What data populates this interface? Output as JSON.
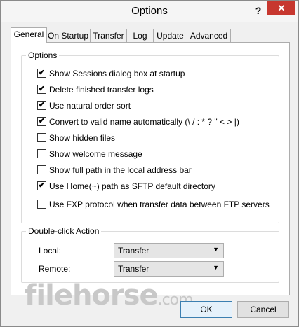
{
  "window": {
    "title": "Options",
    "help_label": "?",
    "close_label": "✕"
  },
  "tabs": [
    {
      "label": "General",
      "active": true
    },
    {
      "label": "On Startup",
      "active": false
    },
    {
      "label": "Transfer",
      "active": false
    },
    {
      "label": "Log",
      "active": false
    },
    {
      "label": "Update",
      "active": false
    },
    {
      "label": "Advanced",
      "active": false
    }
  ],
  "options": {
    "group_label": "Options",
    "items": [
      {
        "label": "Show Sessions dialog box at startup",
        "checked": true
      },
      {
        "label": "Delete finished transfer logs",
        "checked": true
      },
      {
        "label": "Use natural order sort",
        "checked": true
      },
      {
        "label": "Convert to valid name automatically (\\ / : * ? \" < > |)",
        "checked": true
      },
      {
        "label": "Show hidden files",
        "checked": false
      },
      {
        "label": "Show welcome message",
        "checked": false
      },
      {
        "label": "Show full path in the local address bar",
        "checked": false
      },
      {
        "label": "Use Home(~) path as SFTP default directory",
        "checked": true
      },
      {
        "label": "Use FXP protocol when transfer data between FTP servers",
        "checked": false
      }
    ]
  },
  "double_click": {
    "group_label": "Double-click Action",
    "local_label": "Local:",
    "local_value": "Transfer",
    "remote_label": "Remote:",
    "remote_value": "Transfer"
  },
  "watermark": {
    "text": "filehorse",
    "suffix": ".com"
  },
  "buttons": {
    "ok": "OK",
    "cancel": "Cancel"
  },
  "icons": {
    "check": "✔",
    "dropdown": "▼"
  }
}
